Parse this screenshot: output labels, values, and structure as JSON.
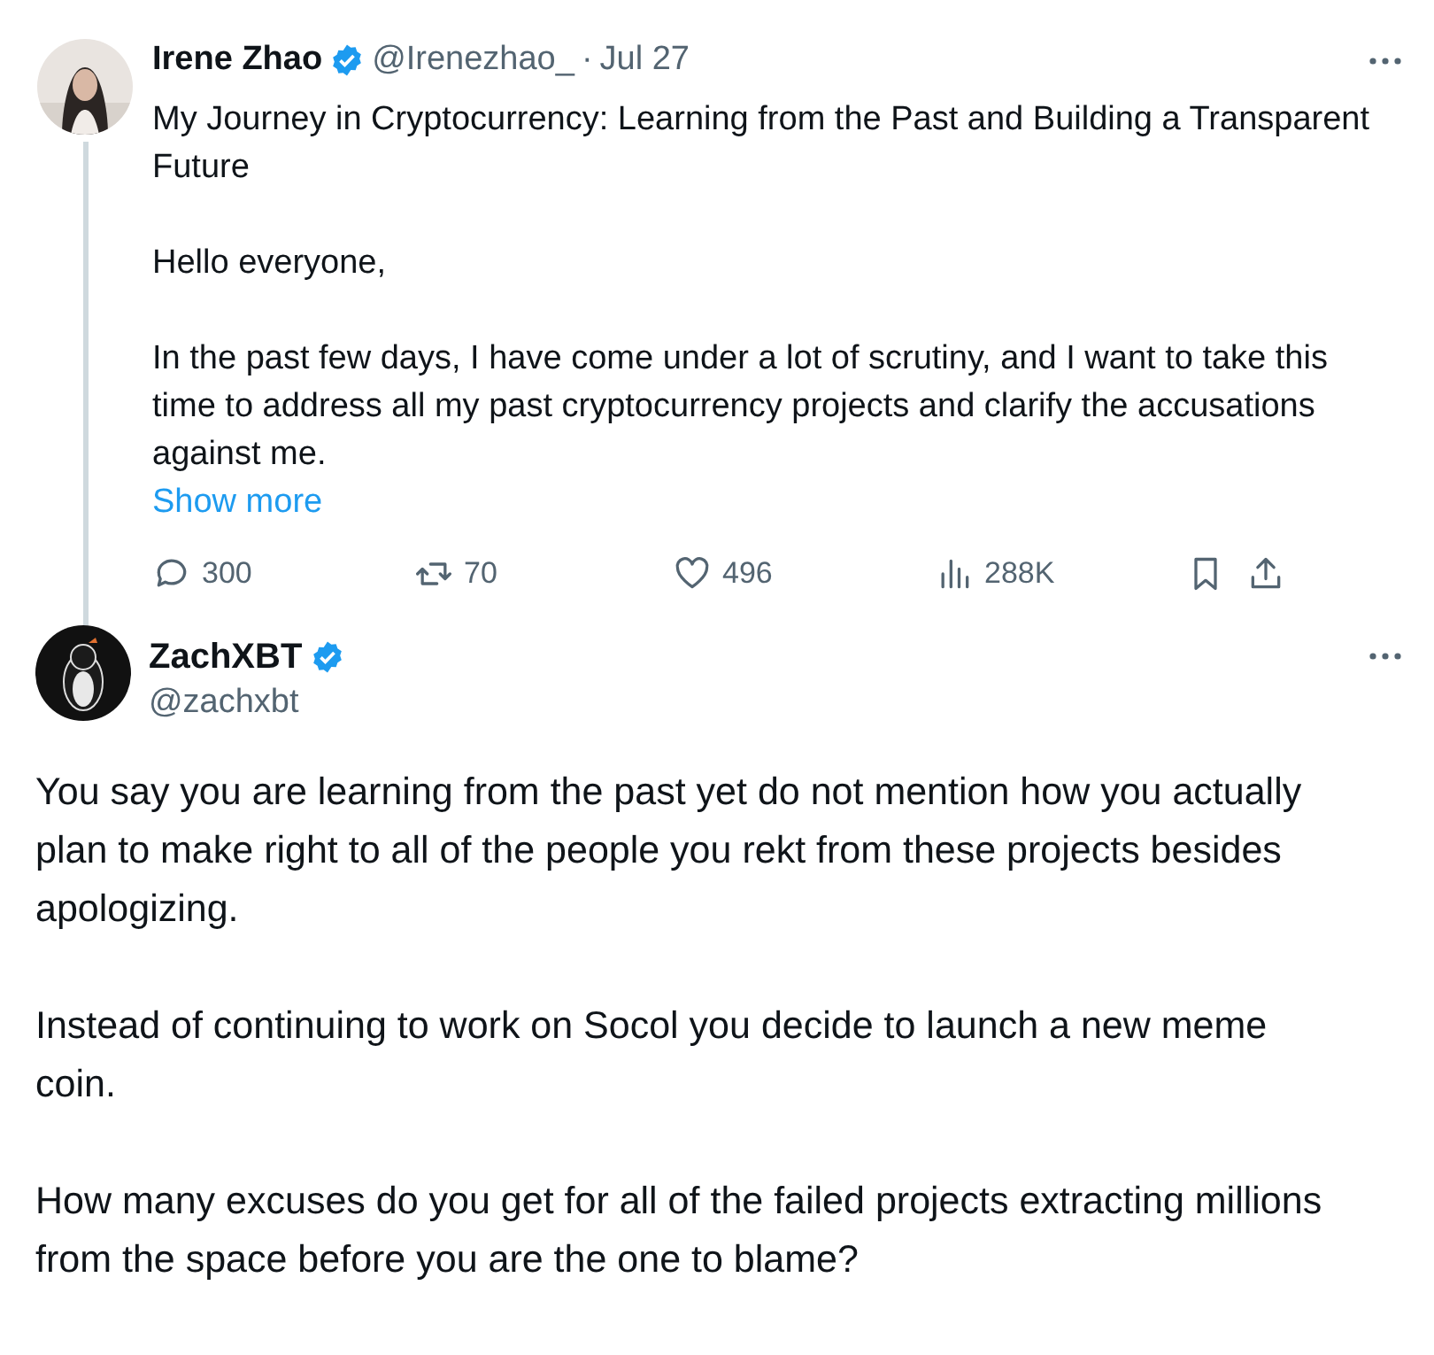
{
  "reply_to": {
    "name": "Irene Zhao",
    "verified": true,
    "handle": "@Irenezhao_",
    "separator": "·",
    "date": "Jul 27",
    "paragraphs": [
      "My Journey in Cryptocurrency: Learning from the Past and Building a Transparent Future",
      "Hello everyone,",
      "In the past few days, I have come under a lot of scrutiny, and I want to take this time to address all my past cryptocurrency projects and clarify the accusations against me."
    ],
    "show_more": "Show more",
    "actions": [
      {
        "kind": "reply",
        "count": "300"
      },
      {
        "kind": "repost",
        "count": "70"
      },
      {
        "kind": "like",
        "count": "496"
      },
      {
        "kind": "views",
        "count": "288K"
      },
      {
        "kind": "bookmark"
      },
      {
        "kind": "share"
      }
    ]
  },
  "tweet": {
    "name": "ZachXBT",
    "verified": true,
    "handle": "@zachxbt",
    "paragraphs": [
      "You say you are learning from the past yet do not mention how you actually plan to make right to all of the people you rekt from these projects besides apologizing.",
      "Instead of continuing to work on Socol you decide to launch a new meme coin.",
      "How many excuses do you get for all of the failed projects extracting millions from the space before you are the one to blame?"
    ]
  }
}
